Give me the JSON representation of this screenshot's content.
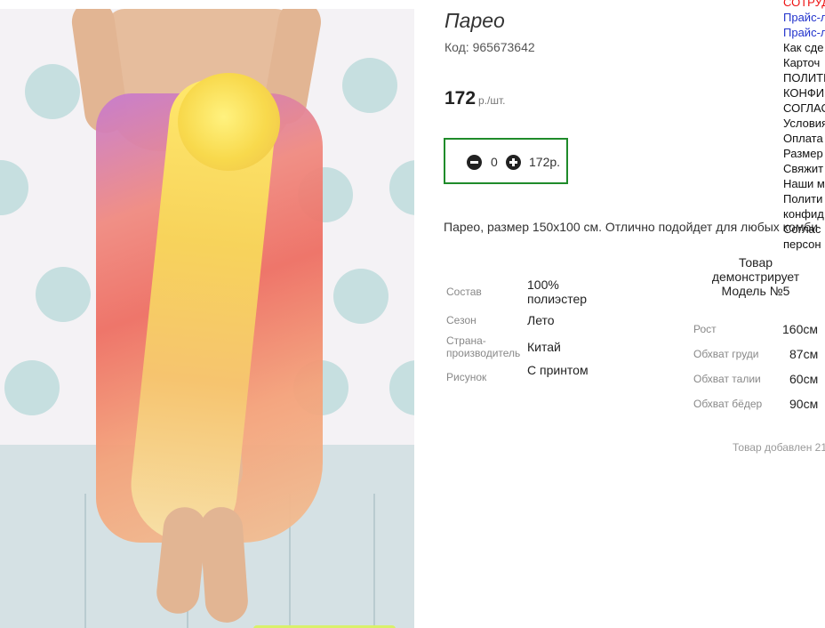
{
  "product": {
    "title": "Парео",
    "code": "Код: 965673642",
    "price": "172",
    "price_unit": "р./шт.",
    "description": "Парео, размер 150х100 см. Отлично подойдет для любых комби",
    "added_text": "Товар добавлен 21"
  },
  "cart": {
    "quantity": "0",
    "sum": "172р.",
    "minus_icon": "minus-circle-icon",
    "plus_icon": "plus-circle-icon",
    "border_color": "#1f8b2a"
  },
  "properties": [
    {
      "label": "Состав",
      "value": "100% полиэстер"
    },
    {
      "label": "Сезон",
      "value": "Лето"
    },
    {
      "label": "Страна-производитель",
      "value": "Китай"
    },
    {
      "label": "Рисунок",
      "value": "С принтом"
    }
  ],
  "model": {
    "title": "Товар демонстрирует Модель №5",
    "rows": [
      {
        "label": "Рост",
        "value": "160см"
      },
      {
        "label": "Обхват груди",
        "value": "87см"
      },
      {
        "label": "Обхват талии",
        "value": "60см"
      },
      {
        "label": "Обхват бёдер",
        "value": "90см"
      }
    ]
  },
  "side_menu": [
    {
      "label": "СОТРУД",
      "color": "#e11"
    },
    {
      "label": "Прайс-л",
      "color": "#2233cc"
    },
    {
      "label": "Прайс-л",
      "color": "#2233cc"
    },
    {
      "label": "Как сде",
      "color": "#111"
    },
    {
      "label": "Карточ",
      "color": "#111"
    },
    {
      "label": "ПОЛИТИ",
      "color": "#111"
    },
    {
      "label": "КОНФИ",
      "color": "#111"
    },
    {
      "label": "СОГЛАС",
      "color": "#111"
    },
    {
      "label": "Условия",
      "color": "#111"
    },
    {
      "label": "Оплата",
      "color": "#111"
    },
    {
      "label": "Размер",
      "color": "#111"
    },
    {
      "label": "Свяжит",
      "color": "#111"
    },
    {
      "label": "Наши м",
      "color": "#111"
    },
    {
      "label": "Полити",
      "color": "#111"
    },
    {
      "label": "конфид",
      "color": "#111"
    },
    {
      "label": "Соглас",
      "color": "#111"
    },
    {
      "label": "персон",
      "color": "#111"
    }
  ]
}
